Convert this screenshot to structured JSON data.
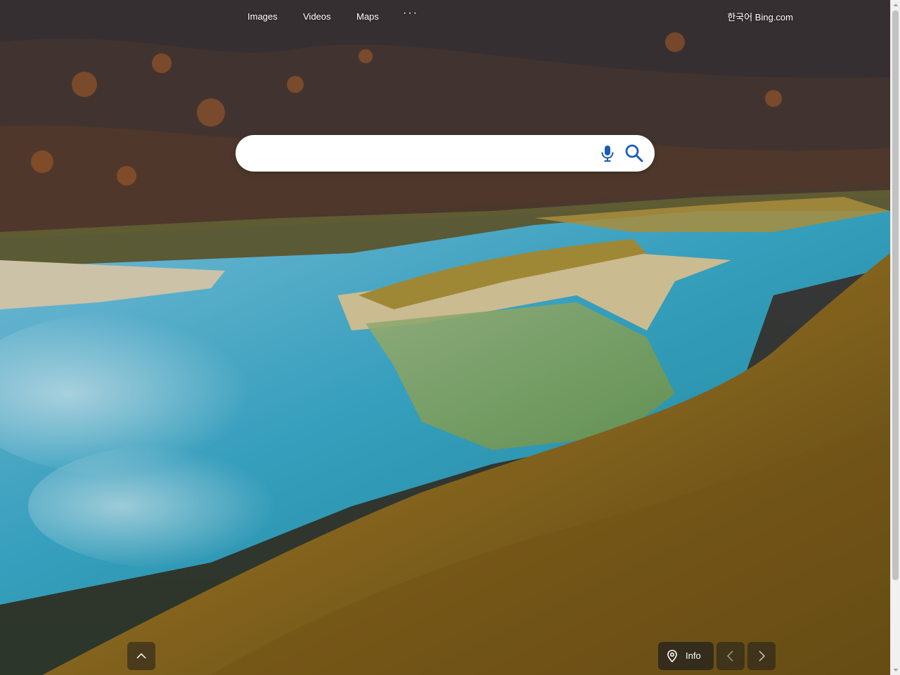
{
  "nav": {
    "images": "Images",
    "videos": "Videos",
    "maps": "Maps",
    "more": "···"
  },
  "region": {
    "label": "한국어 Bing.com"
  },
  "search": {
    "value": "",
    "placeholder": ""
  },
  "bottom": {
    "info_label": "Info"
  },
  "icons": {
    "mic": "microphone-icon",
    "search": "search-icon",
    "scroll_up": "chevron-up-icon",
    "location": "map-pin-icon",
    "prev": "chevron-left-icon",
    "next": "chevron-right-icon"
  },
  "colors": {
    "search_icon": "#1a5bb8",
    "mic_icon": "#1a5bb8",
    "overlay_button": "#1e1e1e"
  }
}
